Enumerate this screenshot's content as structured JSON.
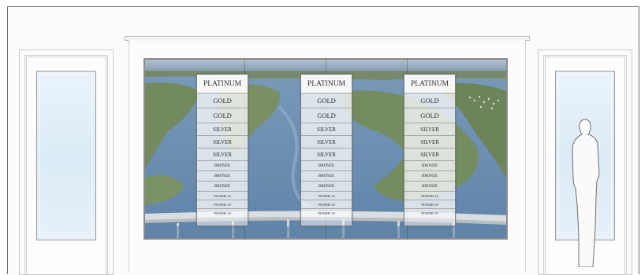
{
  "panels": [
    {
      "levels": [
        {
          "tier": "platinum",
          "label": "PLATINUM"
        },
        {
          "tier": "gold",
          "label": "GOLD"
        },
        {
          "tier": "gold",
          "label": "GOLD"
        },
        {
          "tier": "silver",
          "label": "SILVER"
        },
        {
          "tier": "silver",
          "label": "SILVER"
        },
        {
          "tier": "silver",
          "label": "SILVER"
        },
        {
          "tier": "bronze",
          "label": "BRONZE"
        },
        {
          "tier": "bronze",
          "label": "BRONZE"
        },
        {
          "tier": "bronze",
          "label": "BRONZE"
        },
        {
          "tier": "power",
          "label": "POWER 10"
        },
        {
          "tier": "power",
          "label": "POWER 10"
        },
        {
          "tier": "power",
          "label": "POWER 10"
        }
      ]
    },
    {
      "levels": [
        {
          "tier": "platinum",
          "label": "PLATINUM"
        },
        {
          "tier": "gold",
          "label": "GOLD"
        },
        {
          "tier": "gold",
          "label": "GOLD"
        },
        {
          "tier": "silver",
          "label": "SILVER"
        },
        {
          "tier": "silver",
          "label": "SILVER"
        },
        {
          "tier": "silver",
          "label": "SILVER"
        },
        {
          "tier": "bronze",
          "label": "BRONZE"
        },
        {
          "tier": "bronze",
          "label": "BRONZE"
        },
        {
          "tier": "bronze",
          "label": "BRONZE"
        },
        {
          "tier": "power",
          "label": "POWER 10"
        },
        {
          "tier": "power",
          "label": "POWER 10"
        },
        {
          "tier": "power",
          "label": "POWER 10"
        }
      ]
    },
    {
      "levels": [
        {
          "tier": "platinum",
          "label": "PLATINUM"
        },
        {
          "tier": "gold",
          "label": "GOLD"
        },
        {
          "tier": "gold",
          "label": "GOLD"
        },
        {
          "tier": "silver",
          "label": "SILVER"
        },
        {
          "tier": "silver",
          "label": "SILVER"
        },
        {
          "tier": "silver",
          "label": "SILVER"
        },
        {
          "tier": "bronze",
          "label": "BRONZE"
        },
        {
          "tier": "bronze",
          "label": "BRONZE"
        },
        {
          "tier": "bronze",
          "label": "BRONZE"
        },
        {
          "tier": "power",
          "label": "POWER 10"
        },
        {
          "tier": "power",
          "label": "POWER 10"
        },
        {
          "tier": "power",
          "label": "POWER 10"
        }
      ]
    }
  ],
  "colors": {
    "water": "#3f6f9c",
    "land": "#4f6a3a",
    "bridge": "#cfd3d6",
    "glass": "#e3eef7",
    "panel_border": "#7f7f7f"
  }
}
